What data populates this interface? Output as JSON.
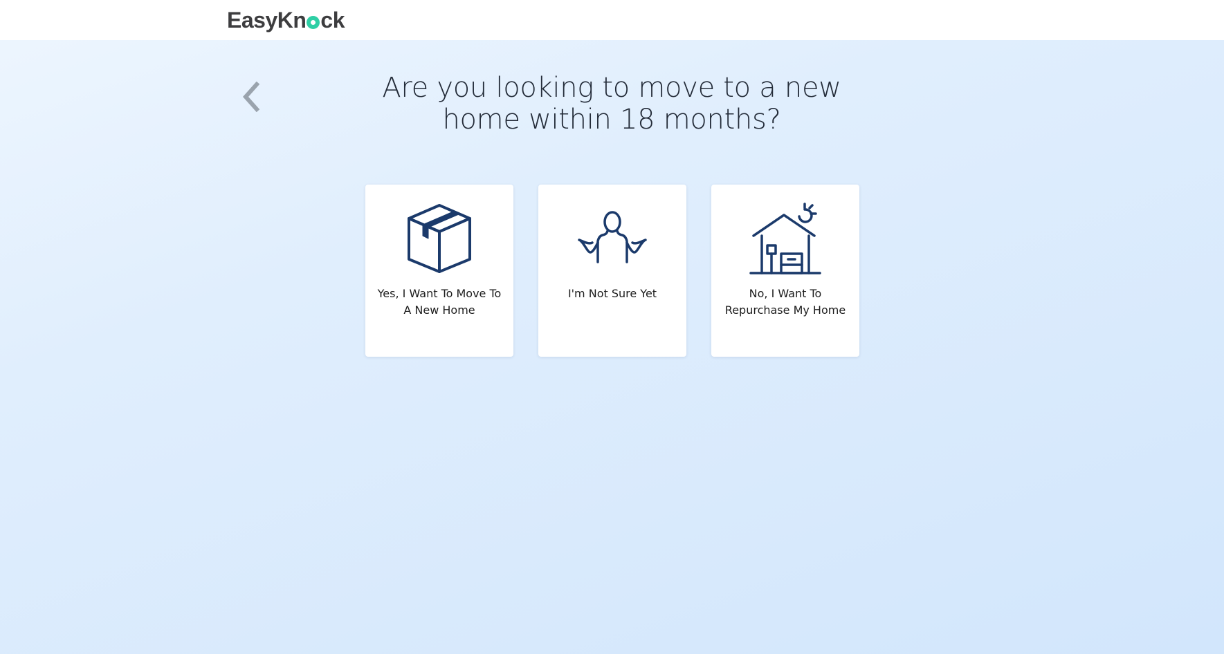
{
  "brand": {
    "logo_part1": "EasyKn",
    "logo_part2": "ck",
    "logo_color": "#3d3d3f",
    "accent_color": "#2ecfa5"
  },
  "navigation": {
    "back_icon": "chevron-left-icon"
  },
  "question": {
    "line1": "Are you looking to move to a new",
    "line2": "home within 18 months?"
  },
  "options": [
    {
      "icon": "moving-box-icon",
      "label": "Yes, I Want To Move To A New Home"
    },
    {
      "icon": "shrugging-person-icon",
      "label": "I'm Not Sure Yet"
    },
    {
      "icon": "house-with-sun-icon",
      "label": "No, I Want To Repurchase My Home"
    }
  ],
  "colors": {
    "icon_navy": "#1b3a6b",
    "background_top": "#eef6fe",
    "background_bottom": "#d2e6fc"
  }
}
